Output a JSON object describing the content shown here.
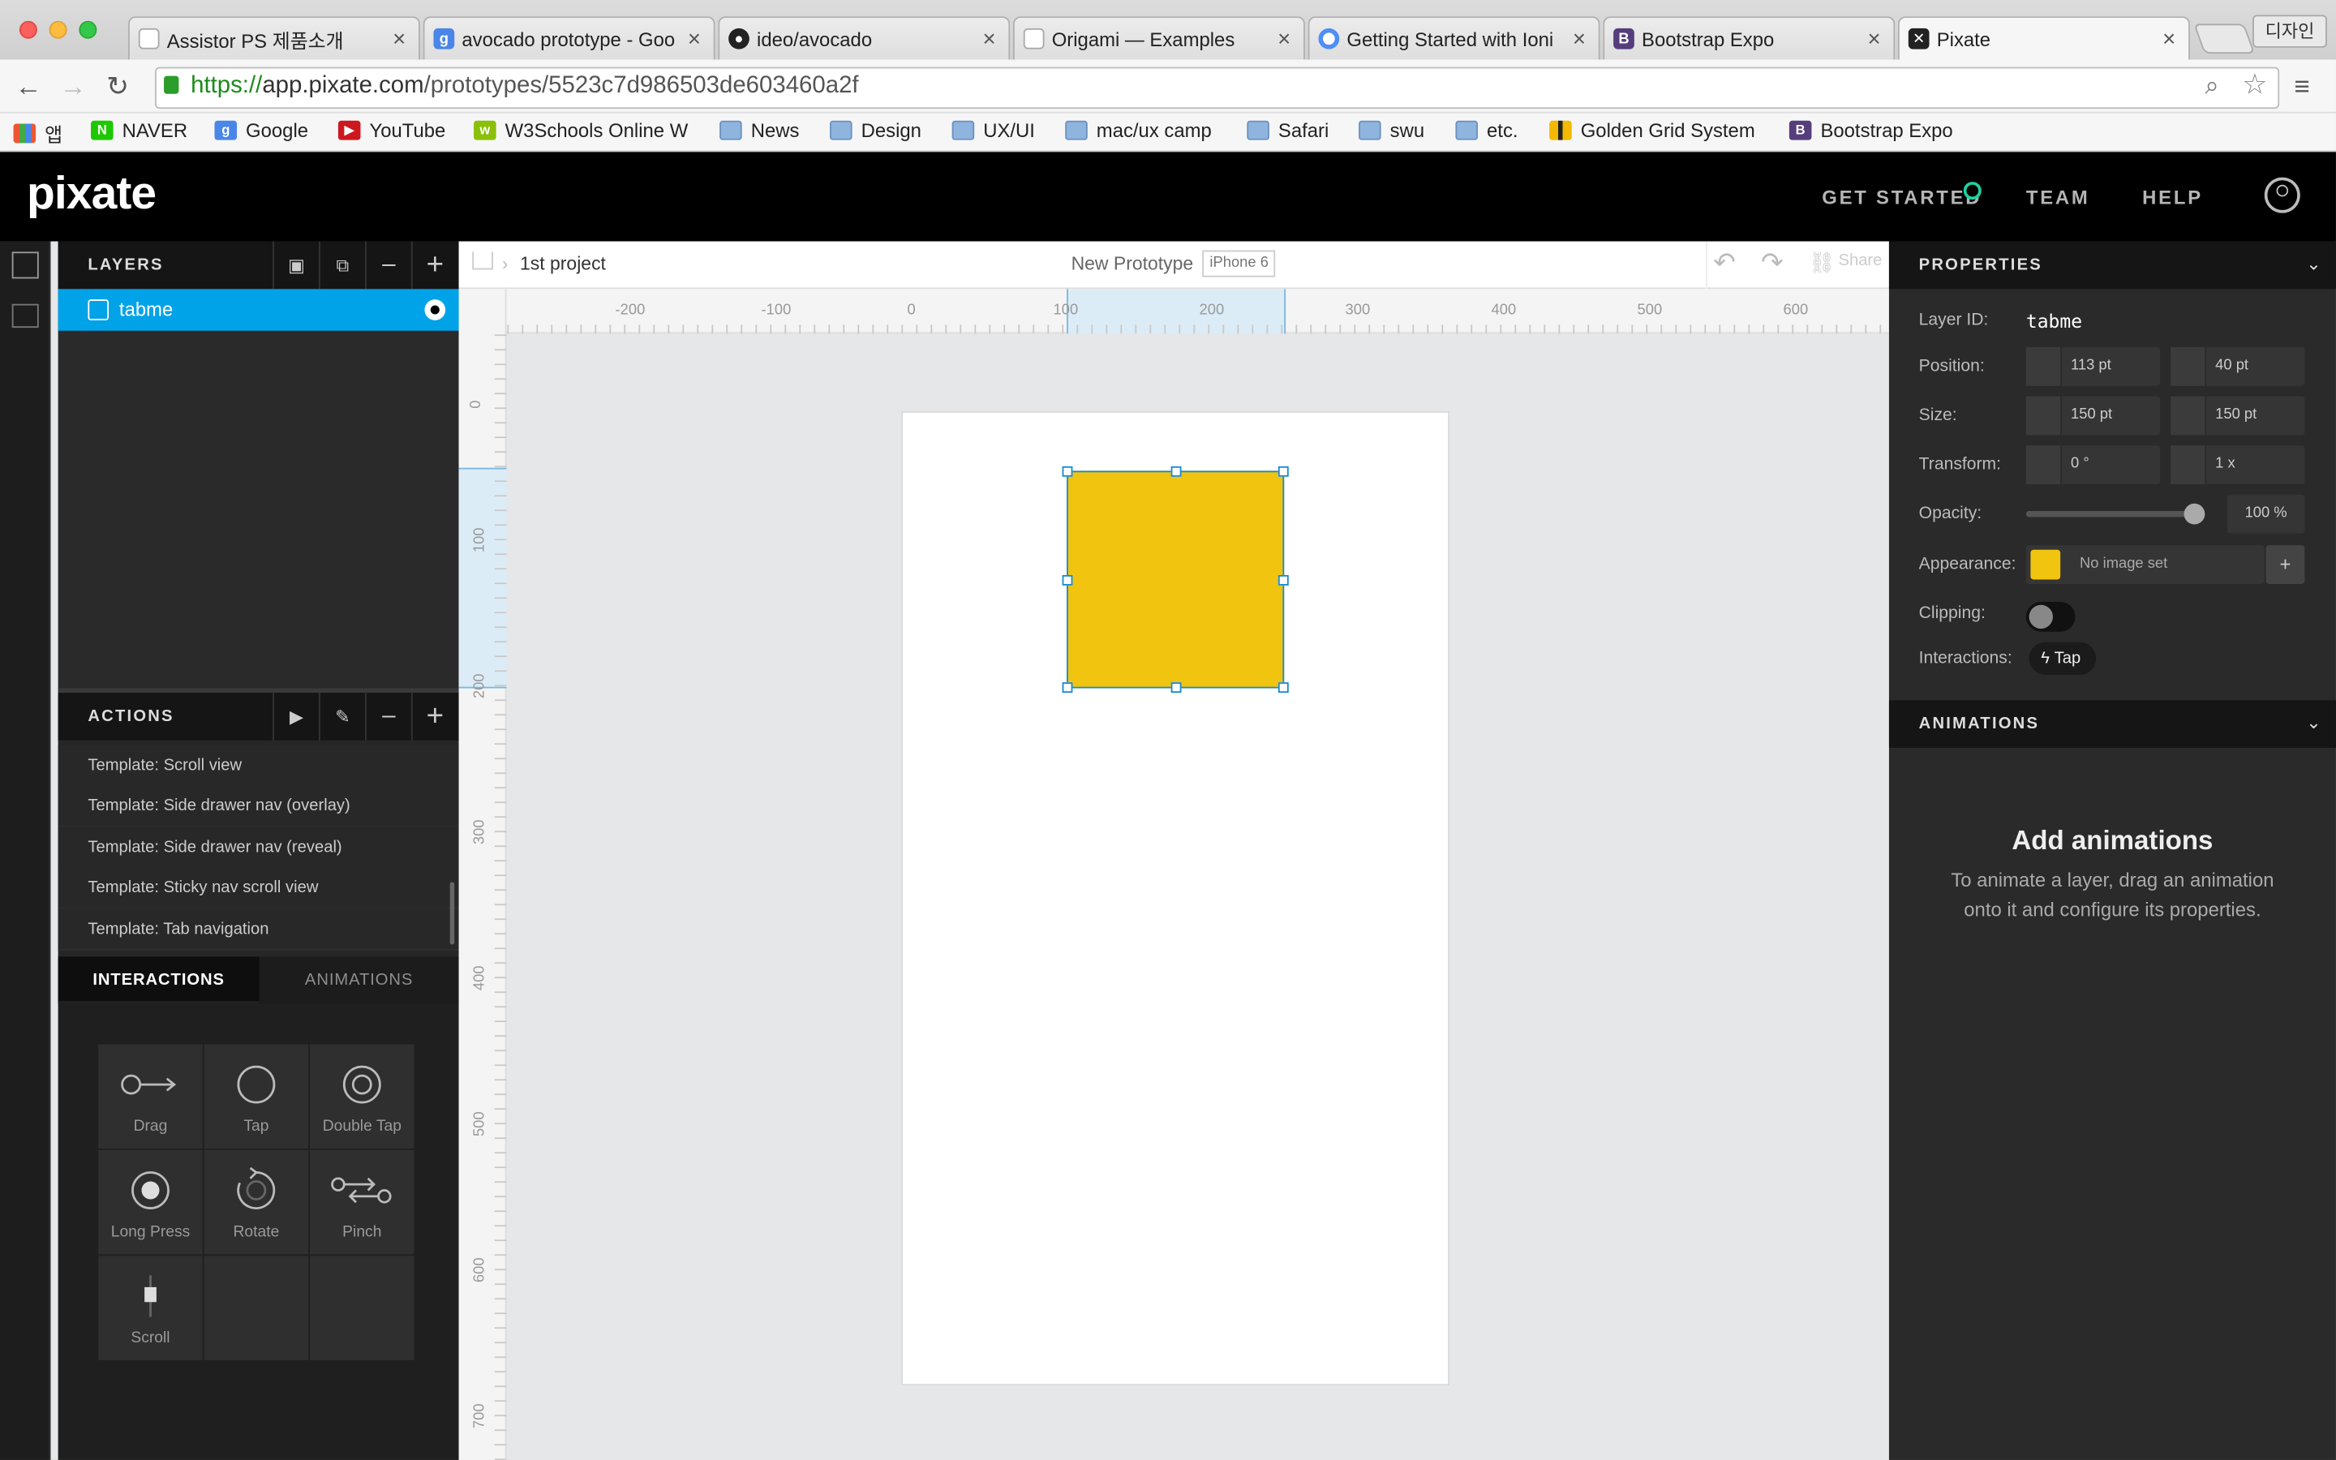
{
  "browser": {
    "tabs": [
      {
        "title": "Assistor PS 제품소개",
        "icon": "doc-icon",
        "color": "#ffffff"
      },
      {
        "title": "avocado prototype - Goo",
        "icon": "google-icon",
        "color": "#4a86e8"
      },
      {
        "title": "ideo/avocado",
        "icon": "github-icon",
        "color": "#222222"
      },
      {
        "title": "Origami — Examples",
        "icon": "doc-icon",
        "color": "#ffffff"
      },
      {
        "title": "Getting Started with Ioni",
        "icon": "ionic-icon",
        "color": "#4e8ef7"
      },
      {
        "title": "Bootstrap Expo",
        "icon": "bootstrap-icon",
        "color": "#563d7c"
      },
      {
        "title": "Pixate",
        "icon": "pixate-icon",
        "color": "#222222"
      }
    ],
    "profile_button": "디자인",
    "url": {
      "scheme": "https://",
      "host": "app.pixate.com",
      "path": "/prototypes/5523c7d986503de603460a2f"
    },
    "bookmarks": [
      {
        "label": "앱",
        "icon": "apps-icon"
      },
      {
        "label": "NAVER",
        "icon": "naver-icon"
      },
      {
        "label": "Google",
        "icon": "google-icon"
      },
      {
        "label": "YouTube",
        "icon": "youtube-icon"
      },
      {
        "label": "W3Schools Online W",
        "icon": "w3schools-icon"
      },
      {
        "label": "News",
        "icon": "folder-icon"
      },
      {
        "label": "Design",
        "icon": "folder-icon"
      },
      {
        "label": "UX/UI",
        "icon": "folder-icon"
      },
      {
        "label": "mac/ux camp",
        "icon": "folder-icon"
      },
      {
        "label": "Safari",
        "icon": "folder-icon"
      },
      {
        "label": "swu",
        "icon": "folder-icon"
      },
      {
        "label": "etc.",
        "icon": "folder-icon"
      },
      {
        "label": "Golden Grid System",
        "icon": "golden-grid-icon"
      },
      {
        "label": "Bootstrap Expo",
        "icon": "bootstrap-icon"
      }
    ]
  },
  "app": {
    "logo": "pixate",
    "nav": {
      "get_started": "GET STARTED",
      "team": "TEAM",
      "help": "HELP"
    },
    "accent": "#1fd1a1"
  },
  "layers": {
    "title": "LAYERS",
    "items": [
      {
        "name": "tabme"
      }
    ]
  },
  "actions": {
    "title": "ACTIONS",
    "items": [
      "Template: Scroll view",
      "Template: Side drawer nav (overlay)",
      "Template: Side drawer nav (reveal)",
      "Template: Sticky nav scroll view",
      "Template: Tab navigation"
    ]
  },
  "bottom_tabs": {
    "interactions": "INTERACTIONS",
    "animations": "ANIMATIONS"
  },
  "interactions": [
    {
      "label": "Drag",
      "icon": "drag-icon"
    },
    {
      "label": "Tap",
      "icon": "tap-icon"
    },
    {
      "label": "Double Tap",
      "icon": "double-tap-icon"
    },
    {
      "label": "Long Press",
      "icon": "long-press-icon"
    },
    {
      "label": "Rotate",
      "icon": "rotate-icon"
    },
    {
      "label": "Pinch",
      "icon": "pinch-icon"
    },
    {
      "label": "Scroll",
      "icon": "scroll-icon"
    }
  ],
  "canvas": {
    "breadcrumb": "1st project",
    "prototype_name": "New Prototype",
    "device": "iPhone 6",
    "share": "Share",
    "ruler_h": [
      "-200",
      "-100",
      "0",
      "100",
      "200",
      "300",
      "400",
      "500",
      "600"
    ],
    "ruler_v": [
      "0",
      "100",
      "200",
      "300",
      "400",
      "500",
      "600",
      "700"
    ],
    "layer_color": "#f1c40f"
  },
  "properties": {
    "title": "PROPERTIES",
    "layer_id_label": "Layer ID:",
    "layer_id": "tabme",
    "position_label": "Position:",
    "position_x": "113 pt",
    "position_y": "40 pt",
    "size_label": "Size:",
    "width": "150 pt",
    "height": "150 pt",
    "transform_label": "Transform:",
    "rotation": "0 °",
    "scale": "1 x",
    "opacity_label": "Opacity:",
    "opacity": "100 %",
    "opacity_fraction": 1.0,
    "appearance_label": "Appearance:",
    "image": "No image set",
    "clipping_label": "Clipping:",
    "clipping_on": false,
    "interactions_label": "Interactions:",
    "interaction": "Tap"
  },
  "animations_panel": {
    "title": "ANIMATIONS",
    "heading": "Add animations",
    "description": "To animate a layer, drag an animation onto it and configure its properties."
  }
}
